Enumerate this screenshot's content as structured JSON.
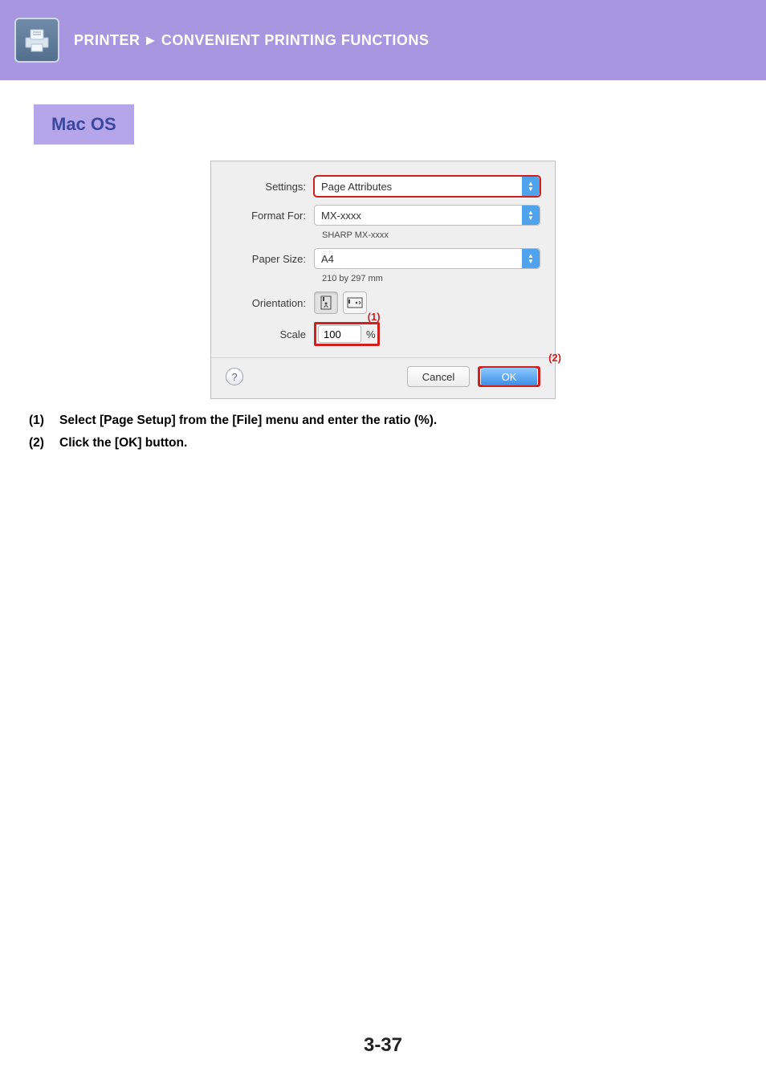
{
  "header": {
    "section": "PRINTER",
    "arrow": "►",
    "title": "CONVENIENT PRINTING FUNCTIONS"
  },
  "section_title": "Mac OS",
  "dialog": {
    "labels": {
      "settings": "Settings:",
      "format_for": "Format For:",
      "paper_size": "Paper Size:",
      "orientation": "Orientation:",
      "scale": "Scale"
    },
    "settings_value": "Page Attributes",
    "format_for_value": "MX-xxxx",
    "format_for_sub": "SHARP MX-xxxx",
    "paper_size_value": "A4",
    "paper_size_sub": "210 by 297 mm",
    "scale_value": "100",
    "scale_unit": "%",
    "help": "?",
    "cancel": "Cancel",
    "ok": "OK",
    "callout1": "(1)",
    "callout2": "(2)"
  },
  "steps": {
    "s1_num": "(1)",
    "s1_text": "Select [Page Setup] from the [File] menu and enter the ratio (%).",
    "s2_num": "(2)",
    "s2_text": "Click the [OK] button."
  },
  "page_number": "3-37"
}
